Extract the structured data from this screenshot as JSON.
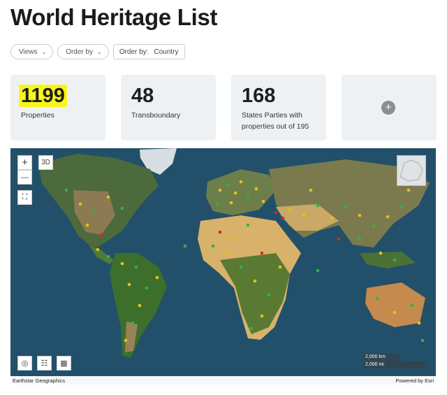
{
  "page": {
    "title": "World Heritage List"
  },
  "toolbar": {
    "views_label": "Views",
    "order_by_label": "Order by",
    "order_by_prefix": "Order by:",
    "order_by_value": "Country"
  },
  "stats": [
    {
      "value": "1199",
      "label": "Properties"
    },
    {
      "value": "48",
      "label": "Transboundary"
    },
    {
      "value": "168",
      "label": "States Parties with properties out of 195"
    }
  ],
  "add_card": {
    "icon": "plus-icon"
  },
  "map": {
    "zoom_in": "+",
    "zoom_out": "—",
    "view_3d": "3D",
    "scale_km": "2,000 km",
    "scale_mi": "2,000 mi",
    "attribution_left": "Earthstar Geographics",
    "attribution_right": "Powered by Esri",
    "marker_colors": {
      "green": "#2db34a",
      "yellow": "#e3c21a",
      "red": "#d12b2b"
    },
    "icons": [
      "zoom-in-icon",
      "zoom-out-icon",
      "fullscreen-icon",
      "compass-icon",
      "layers-icon",
      "basemap-icon"
    ]
  }
}
